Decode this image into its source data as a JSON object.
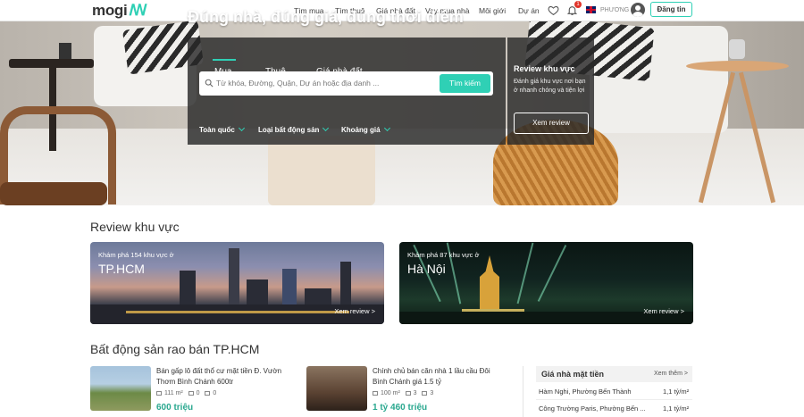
{
  "header": {
    "logo_text": "mogi",
    "nav": [
      {
        "label": "Tìm mua"
      },
      {
        "label": "Tìm thuê"
      },
      {
        "label": "Giá nhà đất"
      },
      {
        "label": "Vay mua nhà"
      },
      {
        "label": "Môi giới"
      },
      {
        "label": "Dự án"
      }
    ],
    "notification_count": "1",
    "user_name": "PHƯƠNG",
    "post_label": "Đăng tin",
    "icons": [
      "heart-icon",
      "bell-icon",
      "uk-flag-icon",
      "user-avatar-icon"
    ]
  },
  "hero": {
    "title": "Đúng nhà, đúng giá, đúng thời điểm",
    "tabs": [
      {
        "label": "Mua",
        "active": true
      },
      {
        "label": "Thuê",
        "active": false
      },
      {
        "label": "Giá nhà đất",
        "active": false
      }
    ],
    "search_placeholder": "Từ khóa, Đường, Quận, Dự án hoặc địa danh ...",
    "search_button": "Tìm kiếm",
    "filters": [
      {
        "label": "Toàn quốc"
      },
      {
        "label": "Loại bất động sản"
      },
      {
        "label": "Khoảng giá"
      }
    ],
    "review": {
      "title": "Review khu vực",
      "description": "Đánh giá khu vực nơi bạn ở nhanh chóng và tiện lợi",
      "button": "Xem review"
    }
  },
  "review_section": {
    "title": "Review khu vực",
    "cards": [
      {
        "subtitle": "Khám phá 154 khu vực ở",
        "city": "TP.HCM",
        "link": "Xem review >"
      },
      {
        "subtitle": "Khám phá 87 khu vực ở",
        "city": "Hà Nội",
        "link": "Xem review >"
      }
    ]
  },
  "listing_section": {
    "title": "Bất động sản rao bán TP.HCM",
    "items": [
      {
        "title": "Bán gấp lô đất thổ cư mặt tiền Đ. Vườn Thơm Bình Chánh 600tr",
        "area": "111 m²",
        "beds": "0",
        "baths": "0",
        "price": "600 triệu"
      },
      {
        "title": "Chính chủ bán căn nhà 1 lầu cầu Đôi Bình Chánh giá 1.5 tỷ",
        "area": "100 m²",
        "beds": "3",
        "baths": "3",
        "price": "1 tỷ 460 triệu"
      }
    ]
  },
  "price_box": {
    "title": "Giá nhà mặt tiền",
    "more": "Xem thêm >",
    "rows": [
      {
        "name": "Hàm Nghi, Phường Bến Thành",
        "value": "1,1 tỷ/m²"
      },
      {
        "name": "Công Trường Paris, Phường Bến ...",
        "value": "1,1 tỷ/m²"
      }
    ]
  },
  "colors": {
    "accent": "#2fd0b5",
    "price": "#2aa88f",
    "badge": "#e0342a"
  }
}
